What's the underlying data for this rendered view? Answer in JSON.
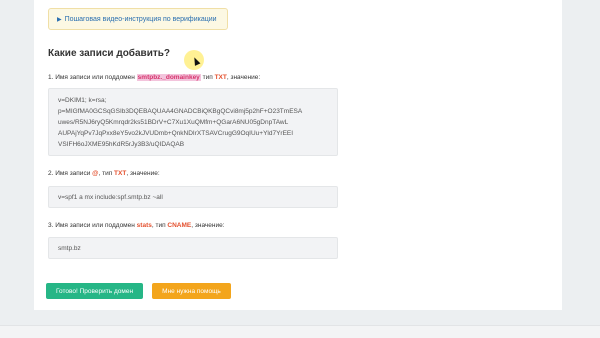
{
  "video_link": {
    "label": "Пошаговая видео-инструкция по верификации",
    "icon": "play-icon"
  },
  "heading": "Какие записи добавить?",
  "steps": [
    {
      "prefix": "1. Имя записи или поддомен",
      "name": "smtpbz._domainkey",
      "mid": "тип",
      "type": "TXT",
      "suffix": ", значение:",
      "value_lines": [
        "v=DKIM1; k=rsa;",
        "p=MIGfMA0GCSqGSIb3DQEBAQUAA4GNADCBiQKBgQCvi8mj5p2hF+O23TmESA",
        "uwes/R5NJ6ryQ5Kmrqdr2ks51BDrV+C7Xu1XuQMfm+QGarA6NU05gDnpTAwL",
        "AUPAjYqPv7JqPxx8eY5vo2kJVUDmb+QnkNDIrXTSAVCrugG9OqIUu+Yld7YrEEI",
        "VSIFH6oJXME95hKdR5rJy3B3/uQIDAQAB"
      ]
    },
    {
      "prefix": "2. Имя записи",
      "name": "@",
      "mid": ", тип",
      "type": "TXT",
      "suffix": ", значение:",
      "value_lines": [
        "v=spf1 a mx include:spf.smtp.bz ~all"
      ]
    },
    {
      "prefix": "3. Имя записи или поддомен",
      "name": "stats",
      "mid": ", тип",
      "type": "CNAME",
      "suffix": ", значение:",
      "value_lines": [
        "smtp.bz"
      ]
    }
  ],
  "buttons": {
    "verify": "Готово! Проверить домен",
    "help": "Мне нужна помощь"
  },
  "colors": {
    "accent_red": "#e4502e",
    "highlight_pink": "#f3c4dc",
    "green": "#26b686",
    "orange": "#f3a51c",
    "link_blue": "#2a6fb0"
  }
}
